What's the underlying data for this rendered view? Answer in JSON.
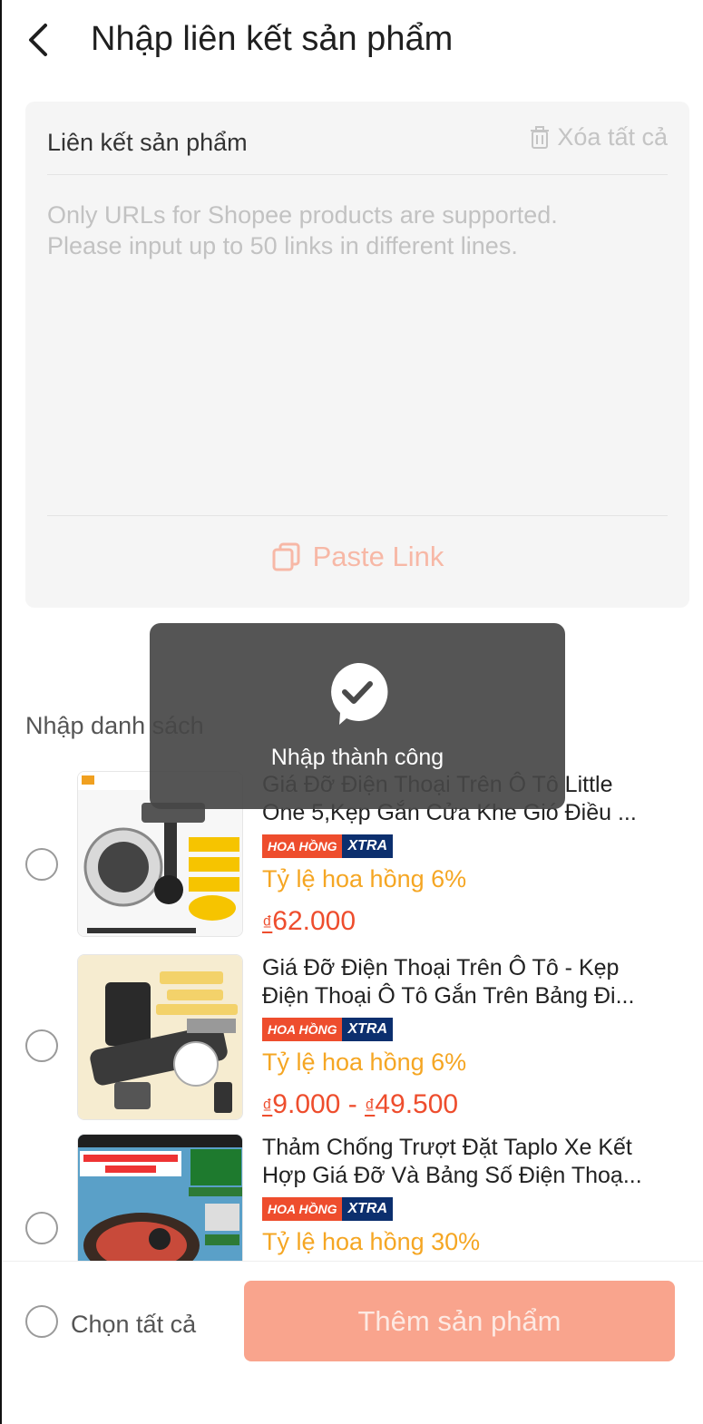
{
  "header": {
    "title": "Nhập liên kết sản phẩm",
    "back_icon": "chevron-left-icon"
  },
  "input_card": {
    "label": "Liên kết sản phẩm",
    "clear_all": "Xóa tất cả",
    "placeholder": "Only URLs for Shopee products are supported.\nPlease input up to 50 links in different lines.",
    "paste_label": "Paste Link"
  },
  "list": {
    "title": "Nhập danh sách",
    "items": [
      {
        "name": "Giá Đỡ Điện Thoại Trên Ô Tô Little One 5,Kẹp Gắn Cửa Khe Gió Điều ...",
        "badge_left": "HOA HỒNG",
        "badge_right": "XTRA",
        "commission": "Tỷ lệ hoa hồng 6%",
        "currency": "₫",
        "price": "62.000"
      },
      {
        "name": "Giá Đỡ Điện Thoại Trên Ô Tô - Kẹp Điện Thoại Ô Tô Gắn Trên Bảng Đi...",
        "badge_left": "HOA HỒNG",
        "badge_right": "XTRA",
        "commission": "Tỷ lệ hoa hồng 6%",
        "currency": "₫",
        "price": "9.000 - ",
        "currency2": "₫",
        "price2": "49.500"
      },
      {
        "name": "Thảm Chống Trượt Đặt Taplo Xe Kết Hợp Giá Đỡ Và Bảng Số Điện Thoạ...",
        "badge_left": "HOA HỒNG",
        "badge_right": "XTRA",
        "commission": "Tỷ lệ hoa hồng 30%"
      }
    ]
  },
  "toast": {
    "message": "Nhập thành công"
  },
  "bottom": {
    "select_all": "Chọn tất cả",
    "add_button": "Thêm sản phẩm"
  },
  "colors": {
    "primary": "#ee4d2d",
    "button_disabled": "#f9a48d",
    "commission": "#f5a623",
    "badge_navy": "#0c2f6e"
  }
}
